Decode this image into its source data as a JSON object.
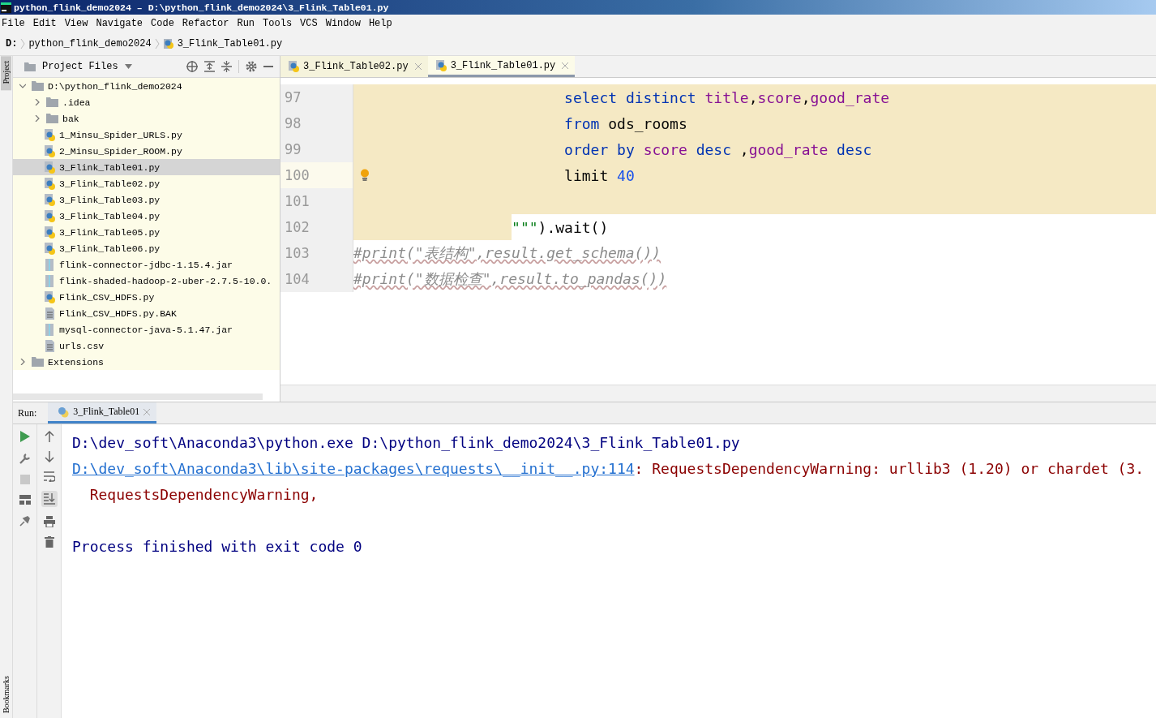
{
  "window": {
    "title": "python_flink_demo2024 – D:\\python_flink_demo2024\\3_Flink_Table01.py"
  },
  "menu": [
    "File",
    "Edit",
    "View",
    "Navigate",
    "Code",
    "Refactor",
    "Run",
    "Tools",
    "VCS",
    "Window",
    "Help"
  ],
  "breadcrumb": [
    "D:",
    "python_flink_demo2024",
    "3_Flink_Table01.py"
  ],
  "side_strip": {
    "top": "Project",
    "bottom": "Bookmarks"
  },
  "project_panel": {
    "title": "Project Files",
    "tree": [
      {
        "label": "D:\\python_flink_demo2024",
        "kind": "folder",
        "expanded": true,
        "selected": false,
        "children": [
          {
            "label": ".idea",
            "kind": "folder",
            "expanded": false,
            "selected": false
          },
          {
            "label": "bak",
            "kind": "folder",
            "expanded": false,
            "selected": false
          },
          {
            "label": "1_Minsu_Spider_URLS.py",
            "kind": "python",
            "selected": false
          },
          {
            "label": "2_Minsu_Spider_ROOM.py",
            "kind": "python",
            "selected": false
          },
          {
            "label": "3_Flink_Table01.py",
            "kind": "python",
            "selected": true
          },
          {
            "label": "3_Flink_Table02.py",
            "kind": "python",
            "selected": false
          },
          {
            "label": "3_Flink_Table03.py",
            "kind": "python",
            "selected": false
          },
          {
            "label": "3_Flink_Table04.py",
            "kind": "python",
            "selected": false
          },
          {
            "label": "3_Flink_Table05.py",
            "kind": "python",
            "selected": false
          },
          {
            "label": "3_Flink_Table06.py",
            "kind": "python",
            "selected": false
          },
          {
            "label": "flink-connector-jdbc-1.15.4.jar",
            "kind": "jar",
            "selected": false
          },
          {
            "label": "flink-shaded-hadoop-2-uber-2.7.5-10.0.",
            "kind": "jar",
            "selected": false
          },
          {
            "label": "Flink_CSV_HDFS.py",
            "kind": "python",
            "selected": false
          },
          {
            "label": "Flink_CSV_HDFS.py.BAK",
            "kind": "text",
            "selected": false
          },
          {
            "label": "mysql-connector-java-5.1.47.jar",
            "kind": "jar",
            "selected": false
          },
          {
            "label": "urls.csv",
            "kind": "text",
            "selected": false
          }
        ]
      },
      {
        "label": "Extensions",
        "kind": "folder",
        "expanded": false,
        "selected": false
      }
    ]
  },
  "editor_tabs": [
    {
      "label": "3_Flink_Table02.py",
      "selected": false
    },
    {
      "label": "3_Flink_Table01.py",
      "selected": true
    }
  ],
  "code_lines": [
    {
      "number": "97",
      "injected": true,
      "closes_string": false,
      "current": false,
      "bulb": false,
      "tokens": [
        {
          "kind": "keyword",
          "text": "select distinct "
        },
        {
          "kind": "field",
          "text": "title"
        },
        {
          "kind": "plain",
          "text": ","
        },
        {
          "kind": "field",
          "text": "score"
        },
        {
          "kind": "plain",
          "text": ","
        },
        {
          "kind": "field",
          "text": "good_rate"
        }
      ]
    },
    {
      "number": "98",
      "injected": true,
      "closes_string": false,
      "current": false,
      "bulb": false,
      "tokens": [
        {
          "kind": "keyword",
          "text": "from "
        },
        {
          "kind": "plain",
          "text": "ods_rooms"
        }
      ]
    },
    {
      "number": "99",
      "injected": true,
      "closes_string": false,
      "current": false,
      "bulb": false,
      "tokens": [
        {
          "kind": "keyword",
          "text": "order by "
        },
        {
          "kind": "field",
          "text": "score"
        },
        {
          "kind": "keyword",
          "text": " desc "
        },
        {
          "kind": "plain",
          "text": ","
        },
        {
          "kind": "field",
          "text": "good_rate"
        },
        {
          "kind": "keyword",
          "text": " desc"
        }
      ]
    },
    {
      "number": "100",
      "injected": true,
      "closes_string": false,
      "current": true,
      "bulb": true,
      "tokens": [
        {
          "kind": "plain",
          "text": "limit "
        },
        {
          "kind": "number",
          "text": "40"
        }
      ]
    },
    {
      "number": "101",
      "injected": true,
      "closes_string": false,
      "current": false,
      "bulb": false
    },
    {
      "number": "102",
      "injected": true,
      "closes_string": true,
      "current": false,
      "bulb": false,
      "tokens": [
        {
          "kind": "string",
          "text": "\"\"\""
        },
        {
          "kind": "plain",
          "text": ").wait()"
        }
      ]
    },
    {
      "number": "103",
      "injected": false,
      "current": false,
      "bulb": false,
      "tokens": [
        {
          "kind": "comment",
          "text": "#print(\"表结构\",result.get_schema())"
        }
      ]
    },
    {
      "number": "104",
      "injected": false,
      "current": false,
      "bulb": false,
      "tokens": [
        {
          "kind": "comment",
          "text": "#print(\"数据检查\",result.to_pandas())"
        }
      ]
    }
  ],
  "run_panel": {
    "label": "Run:",
    "tab": {
      "label": "3_Flink_Table01",
      "selected": true
    },
    "output": [
      {
        "kind": "normal",
        "parts": [
          {
            "kind": "command",
            "text": "D:\\dev_soft\\Anaconda3\\python.exe D:\\python_flink_demo2024\\3_Flink_Table01.py"
          }
        ]
      },
      {
        "kind": "normal",
        "parts": [
          {
            "kind": "link",
            "text": "D:\\dev_soft\\Anaconda3\\lib\\site-packages\\requests\\__init__.py:114"
          },
          {
            "kind": "error",
            "text": ": RequestsDependencyWarning: urllib3 (1.20) or chardet (3."
          }
        ]
      },
      {
        "kind": "normal",
        "parts": [
          {
            "kind": "error",
            "text": "  RequestsDependencyWarning,"
          }
        ]
      },
      {
        "kind": "exit",
        "parts": [
          {
            "kind": "command",
            "text": "Process finished with exit code 0"
          }
        ]
      }
    ]
  }
}
